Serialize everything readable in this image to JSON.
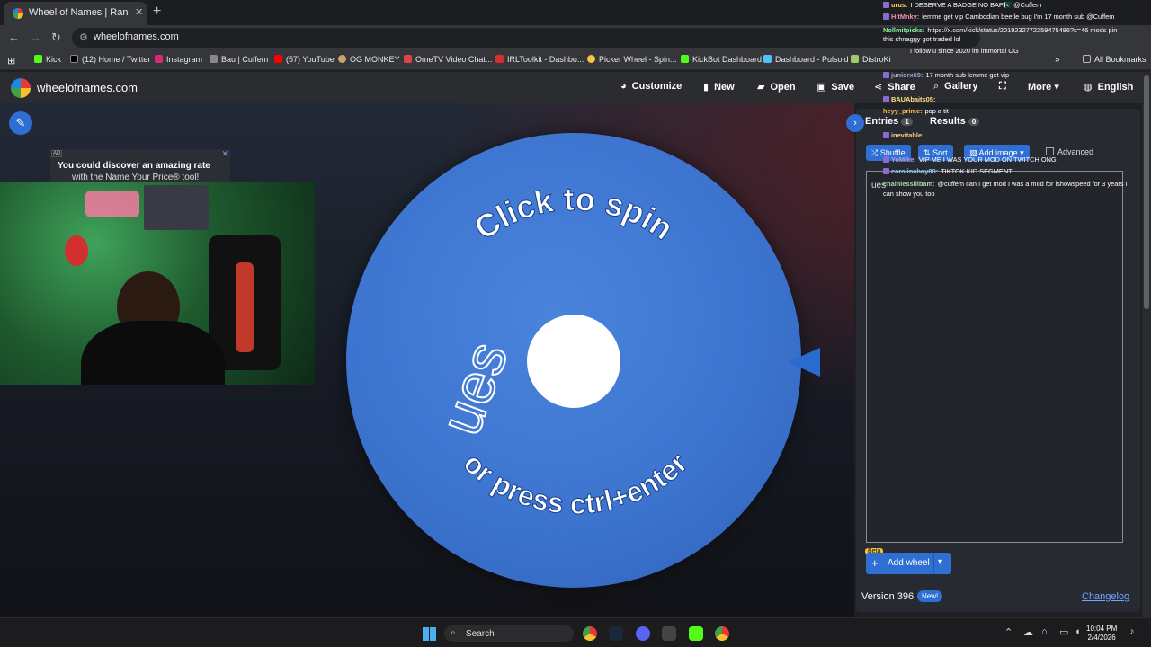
{
  "browser": {
    "tab_title": "Wheel of Names | Random nam",
    "url": "wheelofnames.com",
    "bookmarks": [
      {
        "label": "Kick",
        "color": "#53fc18"
      },
      {
        "label": "(12) Home / Twitter",
        "color": "#000000"
      },
      {
        "label": "Instagram",
        "color": "#d62976"
      },
      {
        "label": "Bau | Cuffem",
        "color": "#888888"
      },
      {
        "label": "(57) YouTube",
        "color": "#ff0000"
      },
      {
        "label": "OG MONKEY",
        "color": "#c9a46a"
      },
      {
        "label": "OmeTV Video Chat...",
        "color": "#e04545"
      },
      {
        "label": "IRLToolkit - Dashbo...",
        "color": "#d32f2f"
      },
      {
        "label": "Picker Wheel - Spin...",
        "color": "#f5c542"
      },
      {
        "label": "KickBot Dashboard",
        "color": "#53fc18"
      },
      {
        "label": "Dashboard - Pulsoid",
        "color": "#4fc3f7"
      },
      {
        "label": "DistroKid",
        "color": "#9ccc65"
      }
    ],
    "all_bookmarks": "All Bookmarks"
  },
  "site": {
    "brand": "wheelofnames.com",
    "nav": {
      "customize": "Customize",
      "new": "New",
      "open": "Open",
      "save": "Save",
      "share": "Share",
      "gallery": "Gallery",
      "more": "More",
      "language": "English"
    }
  },
  "ad": {
    "tag": "AD",
    "line1": "You could discover an amazing rate",
    "line2": "with the Name Your Price® tool!"
  },
  "wheel": {
    "top_text": "Click to spin",
    "bottom_text": "or press ctrl+enter",
    "accent": "#3c74cf"
  },
  "sidebar": {
    "entries_tab": "Entries",
    "entries_count": "1",
    "results_tab": "Results",
    "results_count": "0",
    "shuffle": "Shuffle",
    "sort": "Sort",
    "add_image": "Add image",
    "advanced": "Advanced",
    "entries_value": "ues",
    "beta": "Beta",
    "add_wheel": "Add wheel",
    "version": "Version 396",
    "new_badge": "New!",
    "changelog": "Changelog"
  },
  "chat": [
    {
      "user": "urus:",
      "color": "#ffd54f",
      "msg": "I DESERVE A BADGE NO BAP🇵🇰 @Cuffem"
    },
    {
      "user": "HitMnky:",
      "color": "#f48fb1",
      "msg": "lemme get vip Cambodian beetle bug I'm 17 month sub @Cuffem"
    },
    {
      "user": "Nollmitpicks:",
      "color": "#8ef0a0",
      "msg": "https://x.com/kick/status/2019232772259475486?s=46 mods pin"
    },
    {
      "user": "",
      "color": "#ffffff",
      "msg": "this shnaggy got traded lol"
    },
    {
      "user": "",
      "color": "#ffffff",
      "msg": "I follow u since 2020 im immortal OG"
    },
    {
      "user": "juniorx69:",
      "color": "#9fa8da",
      "msg": "17 month sub lemme get vip"
    },
    {
      "user": "BAUAbaits05:",
      "color": "#ffe082",
      "msg": ""
    },
    {
      "user": "heyy_prime:",
      "color": "#ffb74d",
      "msg": "pop a tit"
    },
    {
      "user": "inevitable:",
      "color": "#ffcc80",
      "msg": ""
    },
    {
      "user": "YoMike:",
      "color": "#b39ddb",
      "msg": "VIP ME I WAS YOUR MOD ON TWITCH ONG"
    },
    {
      "user": "carolinaboy80:",
      "color": "#90caf9",
      "msg": "TIKTOK KID SEGMENT"
    },
    {
      "user": "chainlesslilbam:",
      "color": "#a5d6a7",
      "msg": "@cuffem can I get mod I was a mod for ishowspeed for 3 years I"
    },
    {
      "user": "",
      "color": "#ffffff",
      "msg": "can show you too"
    }
  ],
  "taskbar": {
    "search": "Search",
    "time": "10:04 PM",
    "date": "2/4/2026"
  }
}
